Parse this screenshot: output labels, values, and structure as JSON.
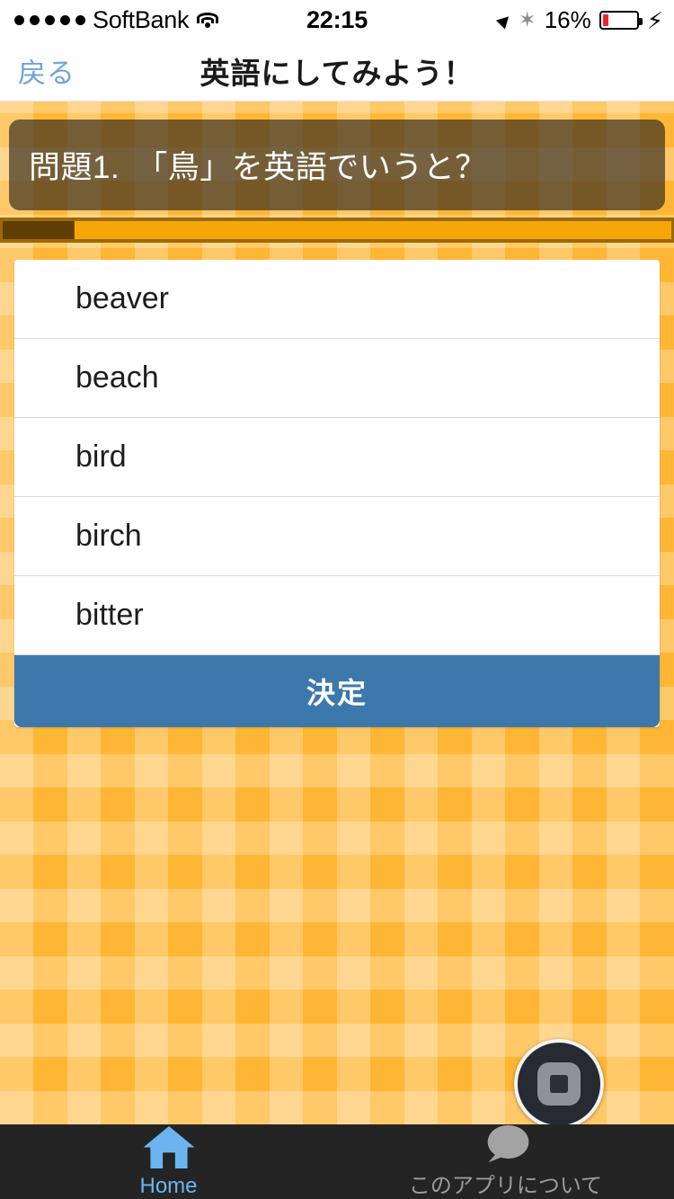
{
  "status_bar": {
    "signal_dots": 5,
    "carrier": "SoftBank",
    "wifi_icon": "wifi-icon",
    "time": "22:15",
    "location_icon": "location-arrow-icon",
    "bluetooth_icon": "bluetooth-icon",
    "bluetooth_glyph": "✶",
    "battery_percent": "16%",
    "battery_level": 16,
    "battery_color": "#e8262a",
    "charging_icon": "lightning-bolt-icon",
    "charging_glyph": "⚡"
  },
  "nav_bar": {
    "back_label": "戻る",
    "back_color": "#6ea4d8",
    "title": "英語にしてみよう！"
  },
  "question": {
    "text": "問題1.　「鳥」を英語でいうと？",
    "panel_color": "rgba(58,48,33,0.70)"
  },
  "progress": {
    "elapsed_percent": 10.7,
    "track_color": "#f5a70a",
    "elapsed_color": "#5e3e02",
    "frame_color": "#9c6a05"
  },
  "answers": {
    "options": [
      {
        "label": "beaver"
      },
      {
        "label": "beach"
      },
      {
        "label": "bird"
      },
      {
        "label": "birch"
      },
      {
        "label": "bitter"
      }
    ],
    "decide_label": "決定",
    "decide_color": "#3d78ad"
  },
  "assistive_touch": {
    "icon": "assistive-touch-icon"
  },
  "tab_bar": {
    "background": "#242424",
    "tabs": [
      {
        "icon": "home-icon",
        "label": "Home",
        "active": true,
        "color": "#6cb4f0"
      },
      {
        "icon": "chat-bubble-icon",
        "label": "このアプリについて",
        "active": false,
        "color": "#9b9b9b"
      }
    ]
  },
  "theme": {
    "background_orange": "#ffb635",
    "accent_blue": "#3d78ad"
  }
}
